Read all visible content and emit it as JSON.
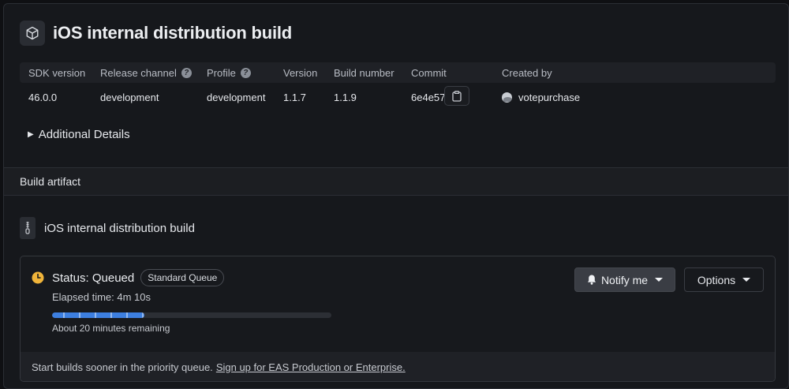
{
  "header": {
    "title": "iOS internal distribution build",
    "icon": "package-icon"
  },
  "meta": {
    "columns": [
      "SDK version",
      "Release channel",
      "Profile",
      "Version",
      "Build number",
      "Commit",
      "Created by"
    ],
    "values": [
      "46.0.0",
      "development",
      "development",
      "1.1.7",
      "1.1.9",
      "6e4e570",
      "votepurchase"
    ],
    "help_glyph": "?"
  },
  "details": {
    "label": "Additional Details"
  },
  "section": {
    "title": "Build artifact"
  },
  "artifact": {
    "name": "iOS internal distribution build",
    "icon": "zip-file-icon"
  },
  "status": {
    "label": "Status: Queued",
    "queue": "Standard Queue",
    "elapsed": "Elapsed time: 4m 10s",
    "remaining": "About 20 minutes remaining",
    "progress_fraction": 0.33,
    "accent_color": "#3d7fe0",
    "status_color": "#f0b43a"
  },
  "actions": {
    "notify": "Notify me",
    "options": "Options"
  },
  "footer": {
    "text": "Start builds sooner in the priority queue.",
    "link": "Sign up for EAS Production or Enterprise."
  }
}
